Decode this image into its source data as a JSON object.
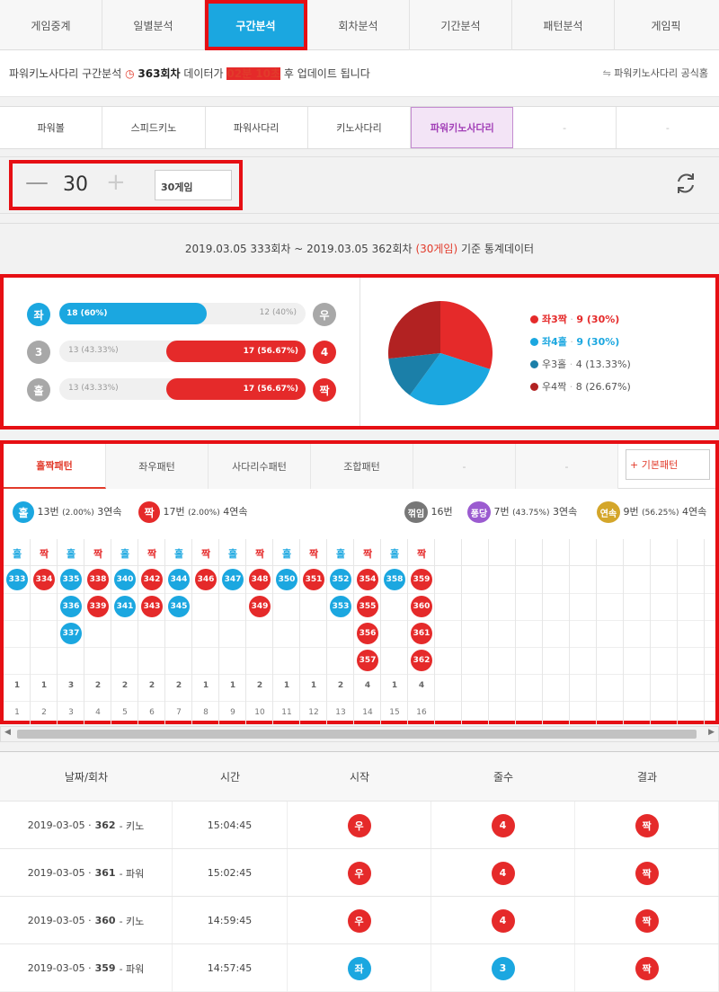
{
  "nav": [
    "게임중계",
    "일별분석",
    "구간분석",
    "회차분석",
    "기간분석",
    "패턴분석",
    "게임픽"
  ],
  "info": {
    "prefix": "파워키노사다리 구간분석",
    "round": "363회차",
    "mid": "데이터가",
    "time": "02분 10초",
    "suffix": "후 업데이트 됩니다",
    "official": "파워키노사다리 공식홈"
  },
  "game_tabs": [
    "파워볼",
    "스피드키노",
    "파워사다리",
    "키노사다리",
    "파워키노사다리",
    "-",
    "-"
  ],
  "control": {
    "minus": "—",
    "count": "30",
    "plus": "+",
    "select": "30게임"
  },
  "date_range": {
    "text": "2019.03.05 333회차 ~ 2019.03.05 362회차",
    "highlight": "(30게임)",
    "suffix": "기준 통계데이터"
  },
  "stats": [
    {
      "left_label": "좌",
      "left_value": "18 (60%)",
      "left_pct": 60,
      "right_label": "우",
      "right_value": "12 (40%)",
      "left_color": "#1ba7e0",
      "right_color": "#a8a8a8"
    },
    {
      "left_label": "3",
      "left_value": "13 (43.33%)",
      "left_pct": 43.33,
      "right_label": "4",
      "right_value": "17 (56.67%)",
      "left_color": "#a8a8a8",
      "right_color": "#e52a2a"
    },
    {
      "left_label": "홀",
      "left_value": "13 (43.33%)",
      "left_pct": 43.33,
      "right_label": "짝",
      "right_value": "17 (56.67%)",
      "left_color": "#a8a8a8",
      "right_color": "#e52a2a"
    }
  ],
  "chart_data": {
    "type": "pie",
    "categories": [
      "좌3짝",
      "좌4홀",
      "우3홀",
      "우4짝"
    ],
    "values": [
      9,
      9,
      4,
      8
    ],
    "colors": [
      "#e52a2a",
      "#1ba7e0",
      "#1b7fa8",
      "#b22222"
    ]
  },
  "legend": [
    {
      "name": "좌3짝",
      "value": "9 (30%)",
      "color": "#e52a2a",
      "bold": true
    },
    {
      "name": "좌4홀",
      "value": "9 (30%)",
      "color": "#1ba7e0",
      "bold": true
    },
    {
      "name": "우3홀",
      "value": "4 (13.33%)",
      "color": "#1b7fa8",
      "bold": false
    },
    {
      "name": "우4짝",
      "value": "8 (26.67%)",
      "color": "#b22222",
      "bold": false
    }
  ],
  "pattern_tabs": [
    "홀짝패턴",
    "좌우패턴",
    "사다리수패턴",
    "조합패턴",
    "-",
    "-"
  ],
  "basic_pattern": "+ 기본패턴",
  "summary": {
    "odd_label": "홀",
    "odd_text": "13번",
    "odd_small": "(2.00%)",
    "odd_streak": "3연속",
    "even_label": "짝",
    "even_text": "17번",
    "even_small": "(2.00%)",
    "even_streak": "4연속",
    "break_label": "꺾임",
    "break_text": "16번",
    "pong_label": "퐁당",
    "pong_text": "7번",
    "pong_small": "(43.75%)",
    "pong_streak": "3연속",
    "cont_label": "연속",
    "cont_text": "9번",
    "cont_small": "(56.25%)",
    "cont_streak": "4연속"
  },
  "pattern_cols": [
    {
      "h": "홀",
      "c": "b",
      "r": [
        "333"
      ]
    },
    {
      "h": "짝",
      "c": "r",
      "r": [
        "334"
      ]
    },
    {
      "h": "홀",
      "c": "b",
      "r": [
        "335",
        "336",
        "337"
      ]
    },
    {
      "h": "짝",
      "c": "r",
      "r": [
        "338",
        "339"
      ]
    },
    {
      "h": "홀",
      "c": "b",
      "r": [
        "340",
        "341"
      ]
    },
    {
      "h": "짝",
      "c": "r",
      "r": [
        "342",
        "343"
      ]
    },
    {
      "h": "홀",
      "c": "b",
      "r": [
        "344",
        "345"
      ]
    },
    {
      "h": "짝",
      "c": "r",
      "r": [
        "346"
      ]
    },
    {
      "h": "홀",
      "c": "b",
      "r": [
        "347"
      ]
    },
    {
      "h": "짝",
      "c": "r",
      "r": [
        "348",
        "349"
      ]
    },
    {
      "h": "홀",
      "c": "b",
      "r": [
        "350"
      ]
    },
    {
      "h": "짝",
      "c": "r",
      "r": [
        "351"
      ]
    },
    {
      "h": "홀",
      "c": "b",
      "r": [
        "352",
        "353"
      ]
    },
    {
      "h": "짝",
      "c": "r",
      "r": [
        "354",
        "355",
        "356",
        "357"
      ]
    },
    {
      "h": "홀",
      "c": "b",
      "r": [
        "358"
      ]
    },
    {
      "h": "짝",
      "c": "r",
      "r": [
        "359",
        "360",
        "361",
        "362"
      ]
    }
  ],
  "pattern_counts": [
    "1",
    "1",
    "3",
    "2",
    "2",
    "2",
    "2",
    "1",
    "1",
    "2",
    "1",
    "1",
    "2",
    "4",
    "1",
    "4"
  ],
  "pattern_index": [
    "1",
    "2",
    "3",
    "4",
    "5",
    "6",
    "7",
    "8",
    "9",
    "10",
    "11",
    "12",
    "13",
    "14",
    "15",
    "16"
  ],
  "table": {
    "headers": [
      "날짜/회차",
      "시간",
      "시작",
      "줄수",
      "결과"
    ],
    "rows": [
      {
        "date": "2019-03-05 ·",
        "round": "362",
        "game": "- 키노",
        "time": "15:04:45",
        "start": "우",
        "start_c": "#e52a2a",
        "lines": "4",
        "lines_c": "#e52a2a",
        "result": "짝",
        "result_c": "#e52a2a"
      },
      {
        "date": "2019-03-05 ·",
        "round": "361",
        "game": "- 파워",
        "time": "15:02:45",
        "start": "우",
        "start_c": "#e52a2a",
        "lines": "4",
        "lines_c": "#e52a2a",
        "result": "짝",
        "result_c": "#e52a2a"
      },
      {
        "date": "2019-03-05 ·",
        "round": "360",
        "game": "- 키노",
        "time": "14:59:45",
        "start": "우",
        "start_c": "#e52a2a",
        "lines": "4",
        "lines_c": "#e52a2a",
        "result": "짝",
        "result_c": "#e52a2a"
      },
      {
        "date": "2019-03-05 ·",
        "round": "359",
        "game": "- 파워",
        "time": "14:57:45",
        "start": "좌",
        "start_c": "#1ba7e0",
        "lines": "3",
        "lines_c": "#1ba7e0",
        "result": "짝",
        "result_c": "#e52a2a"
      }
    ]
  }
}
